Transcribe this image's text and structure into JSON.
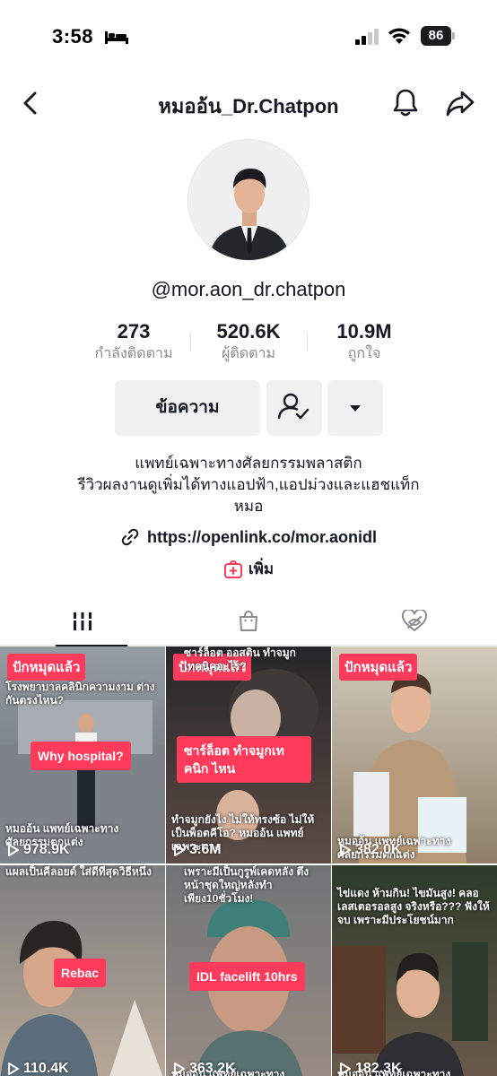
{
  "status": {
    "time": "3:58",
    "battery": "86"
  },
  "nav": {
    "title": "หมออ้น_Dr.Chatpon"
  },
  "profile": {
    "username": "@mor.aon_dr.chatpon",
    "stats": [
      {
        "value": "273",
        "label": "กำลังติดตาม"
      },
      {
        "value": "520.6K",
        "label": "ผู้ติดตาม"
      },
      {
        "value": "10.9M",
        "label": "ถูกใจ"
      }
    ],
    "message_button": "ข้อความ",
    "bio_lines": [
      "แพทย์เฉพาะทางศัลยกรรมพลาสติก",
      "รีวิวผลงานดูเพิ่มได้ทางแอปฟ้า,แอปม่วงและแฮชแท็ก",
      "หมอ"
    ],
    "link": "https://openlink.co/mor.aonidl",
    "add_label": "เพิ่ม"
  },
  "videos": [
    {
      "tag": "ปักหมุดแล้ว",
      "overlay": "Why hospital?",
      "caption_top": "โรงพยาบาลคลินิกความงาม ต่างกันตรงไหน?",
      "caption_bottom": "หมออ้น แพทย์เฉพาะทาง ศัลยกรรมตกแต่ง",
      "views": "978.9K",
      "colors": {
        "top": "#8d949a",
        "bottom": "#5f666c"
      }
    },
    {
      "tag": "ปักหมุดแล้ว",
      "overlay": "ซาร์ล็อต ทำจมูกเทคนิก ไหน",
      "caption_top": "ซาร์ล็อต ออสติน ทำจมูกเทคนิคอะไร?",
      "caption_bottom": "ทำจมูกยังไง ไม่ให้ทรงซ้อ ไม่ให้เป็นพ็อตคีโอ? หมออ้น แพทย์เฉพาะทาง",
      "views": "3.6M",
      "colors": {
        "top": "#2a2a2c",
        "bottom": "#6b5a52"
      }
    },
    {
      "tag": "ปักหมุดแล้ว",
      "overlay": "",
      "caption_top": "",
      "caption_bottom": "หมออ้น แพทย์เฉพาะทาง ศัลยกรรมตกแต่ง",
      "views": "382.0K",
      "colors": {
        "top": "#cfc6b7",
        "bottom": "#8f7f6a"
      }
    },
    {
      "tag": "",
      "overlay": "Rebac",
      "caption_top": "แผลเป็นคีลอยด์ ใส่ดีที่สุดวิธีหนึ่ง",
      "caption_bottom": "",
      "views": "110.4K",
      "colors": {
        "top": "#7d7e80",
        "bottom": "#b9a897"
      }
    },
    {
      "tag": "",
      "overlay": "IDL facelift 10hrs",
      "caption_top": "เพราะมีเป็นกูรูพ์เคดหลัง ตึงหน้าชุดใหญ่หลังทำ เพียง10ชั่วโมง!",
      "caption_bottom": "หมออ้น แพทย์เฉพาะทาง",
      "views": "363.2K",
      "colors": {
        "top": "#6f7476",
        "bottom": "#9a8c84"
      }
    },
    {
      "tag": "",
      "overlay": "",
      "caption_top": "ไข่แดง ห้ามกิน! ไขมันสูง! คลอเลสเตอรอลสูง จริงหรือ??? ฟังให้จบ เพราะมีประโยชน์มาก",
      "caption_bottom": "หมออ้น แพทย์เฉพาะทาง",
      "views": "182.3K",
      "colors": {
        "top": "#2c3b2a",
        "bottom": "#6c5a4b"
      }
    }
  ],
  "accent": "#ff3b5c"
}
